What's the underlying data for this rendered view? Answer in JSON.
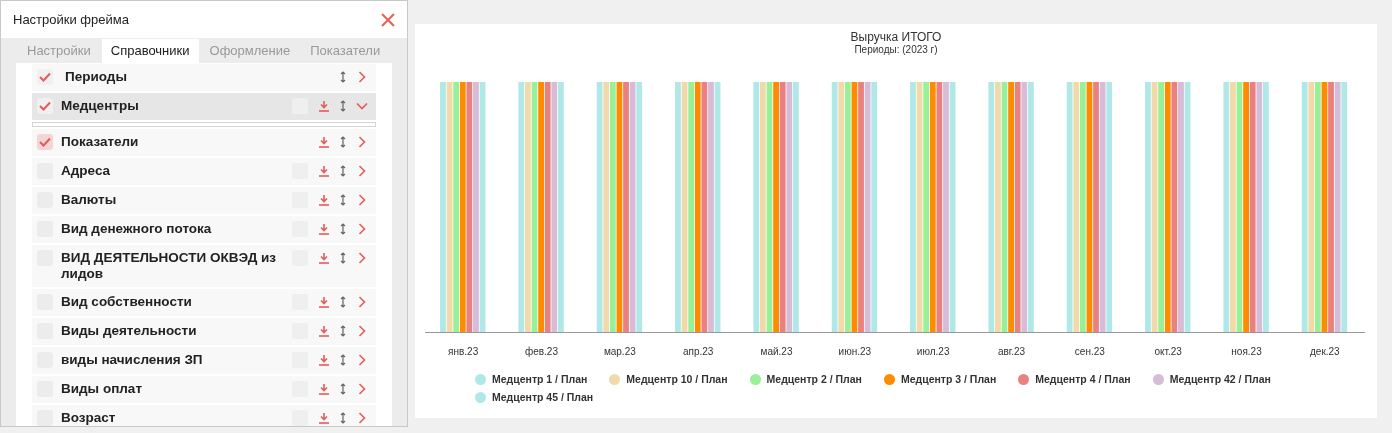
{
  "dialog": {
    "title": "Настройки фрейма"
  },
  "tabs": [
    {
      "label": "Настройки",
      "selected": false
    },
    {
      "label": "Справочники",
      "selected": true
    },
    {
      "label": "Оформление",
      "selected": false
    },
    {
      "label": "Показатели",
      "selected": false
    }
  ],
  "items": [
    {
      "label": "Периоды",
      "kind": "period",
      "checked": true,
      "expanded": false,
      "selected": false
    },
    {
      "label": "Медцентры",
      "kind": "reference",
      "checked": true,
      "expanded": true,
      "selected": true
    },
    {
      "label": "Показатели",
      "kind": "metric",
      "checked": true,
      "expanded": false,
      "selected": false
    },
    {
      "label": "Адреса",
      "kind": "reference",
      "checked": false,
      "expanded": false,
      "selected": false
    },
    {
      "label": "Валюты",
      "kind": "reference",
      "checked": false,
      "expanded": false,
      "selected": false
    },
    {
      "label": "Вид денежного потока",
      "kind": "reference",
      "checked": false,
      "expanded": false,
      "selected": false
    },
    {
      "label": "ВИД ДЕЯТЕЛЬНОСТИ ОКВЭД из лидов",
      "kind": "reference",
      "checked": false,
      "expanded": false,
      "selected": false
    },
    {
      "label": "Вид собственности",
      "kind": "reference",
      "checked": false,
      "expanded": false,
      "selected": false
    },
    {
      "label": "Виды деятельности",
      "kind": "reference",
      "checked": false,
      "expanded": false,
      "selected": false
    },
    {
      "label": "виды начисления ЗП",
      "kind": "reference",
      "checked": false,
      "expanded": false,
      "selected": false
    },
    {
      "label": "Виды оплат",
      "kind": "reference",
      "checked": false,
      "expanded": false,
      "selected": false
    },
    {
      "label": "Возраст",
      "kind": "reference",
      "checked": false,
      "expanded": false,
      "selected": false
    }
  ],
  "chart": {
    "title": "Выручка ИТОГО",
    "subtitle": "Периоды: (2023 г)",
    "categories": [
      "янв.23",
      "фев.23",
      "мар.23",
      "апр.23",
      "май.23",
      "июн.23",
      "июл.23",
      "авг.23",
      "сен.23",
      "окт.23",
      "ноя.23",
      "дек.23"
    ],
    "legend": [
      {
        "label": "Медцентр 1 / План",
        "color": "#b0e8e8"
      },
      {
        "label": "Медцентр 10 / План",
        "color": "#f2d9aa"
      },
      {
        "label": "Медцентр 2 / План",
        "color": "#98f098"
      },
      {
        "label": "Медцентр 3 / План",
        "color": "#ff8c00"
      },
      {
        "label": "Медцентр 4 / План",
        "color": "#ea8080"
      },
      {
        "label": "Медцентр 42 / План",
        "color": "#d6bcd6"
      },
      {
        "label": "Медцентр 45 / План",
        "color": "#b0e8e8"
      }
    ]
  }
}
